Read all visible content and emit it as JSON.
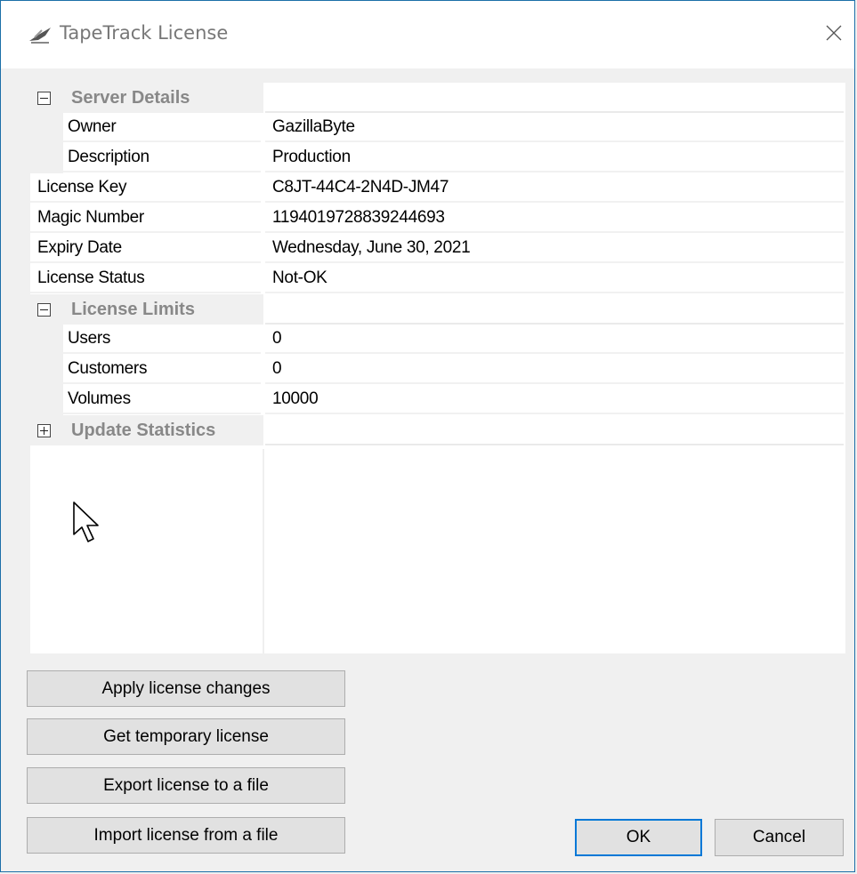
{
  "window": {
    "title": "TapeTrack License",
    "title_icon": "tapetrack-app-icon",
    "close_icon": "close-icon"
  },
  "property_grid": {
    "categories": [
      {
        "name": "Server Details",
        "expanded": true,
        "properties": [
          {
            "name": "Owner",
            "value": "GazillaByte"
          },
          {
            "name": "Description",
            "value": "Production"
          }
        ]
      },
      {
        "name": "License Limits",
        "expanded": true,
        "properties": [
          {
            "name": "Users",
            "value": "0"
          },
          {
            "name": "Customers",
            "value": "0"
          },
          {
            "name": "Volumes",
            "value": "10000"
          }
        ]
      },
      {
        "name": "Update Statistics",
        "expanded": false,
        "properties": []
      }
    ],
    "top_level_properties": [
      {
        "name": "License Key",
        "value": "C8JT-44C4-2N4D-JM47"
      },
      {
        "name": "Magic Number",
        "value": "1194019728839244693"
      },
      {
        "name": "Expiry Date",
        "value": "Wednesday, June 30, 2021"
      },
      {
        "name": "License Status",
        "value": "Not-OK"
      }
    ]
  },
  "buttons": {
    "apply": "Apply license changes",
    "temporary": "Get temporary license",
    "export": "Export license to a file",
    "import": "Import license from a file",
    "ok": "OK",
    "cancel": "Cancel"
  },
  "colors": {
    "focus_border": "#0078d7",
    "window_border": "#1c6fa8",
    "category_text": "#888888"
  }
}
